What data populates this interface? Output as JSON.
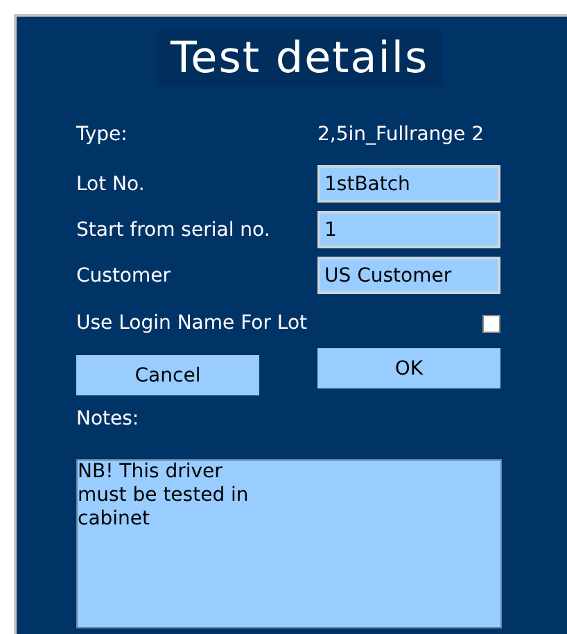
{
  "title": "Test details",
  "type": {
    "label": "Type:",
    "value": "2,5in_Fullrange 2"
  },
  "fields": [
    {
      "label": "Lot No.",
      "value": "1stBatch"
    },
    {
      "label": "Start from serial no.",
      "value": "1"
    },
    {
      "label": "Customer",
      "value": "US Customer"
    }
  ],
  "use_login": {
    "label": "Use Login Name For Lot",
    "checked": false
  },
  "buttons": [
    {
      "label": "Cancel",
      "kind": "cancel"
    },
    {
      "label": "OK",
      "kind": "ok"
    }
  ],
  "notes": {
    "label": "Notes:",
    "value": "NB! This driver\nmust be tested in\ncabinet"
  }
}
